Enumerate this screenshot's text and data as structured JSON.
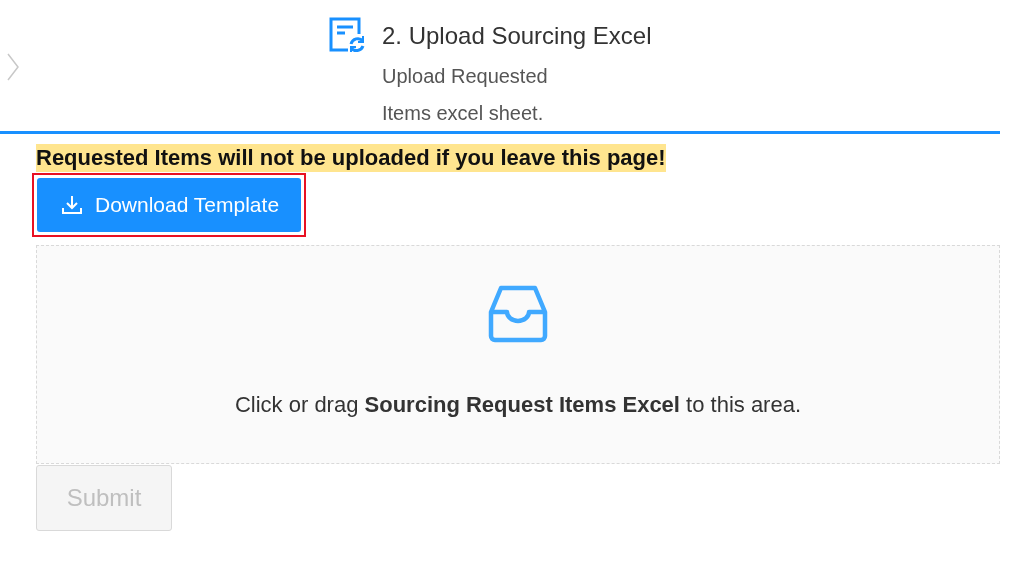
{
  "step": {
    "title": "2. Upload Sourcing Excel",
    "description": "Upload Requested Items excel sheet."
  },
  "warning": "Requested Items will not be uploaded if you leave this page!",
  "download_button": {
    "label": "Download Template",
    "highlighted": true
  },
  "dropzone": {
    "text": "Click or drag **Sourcing Request Items Excel** to this area."
  },
  "submit_button": {
    "label": "Submit",
    "disabled": true
  }
}
